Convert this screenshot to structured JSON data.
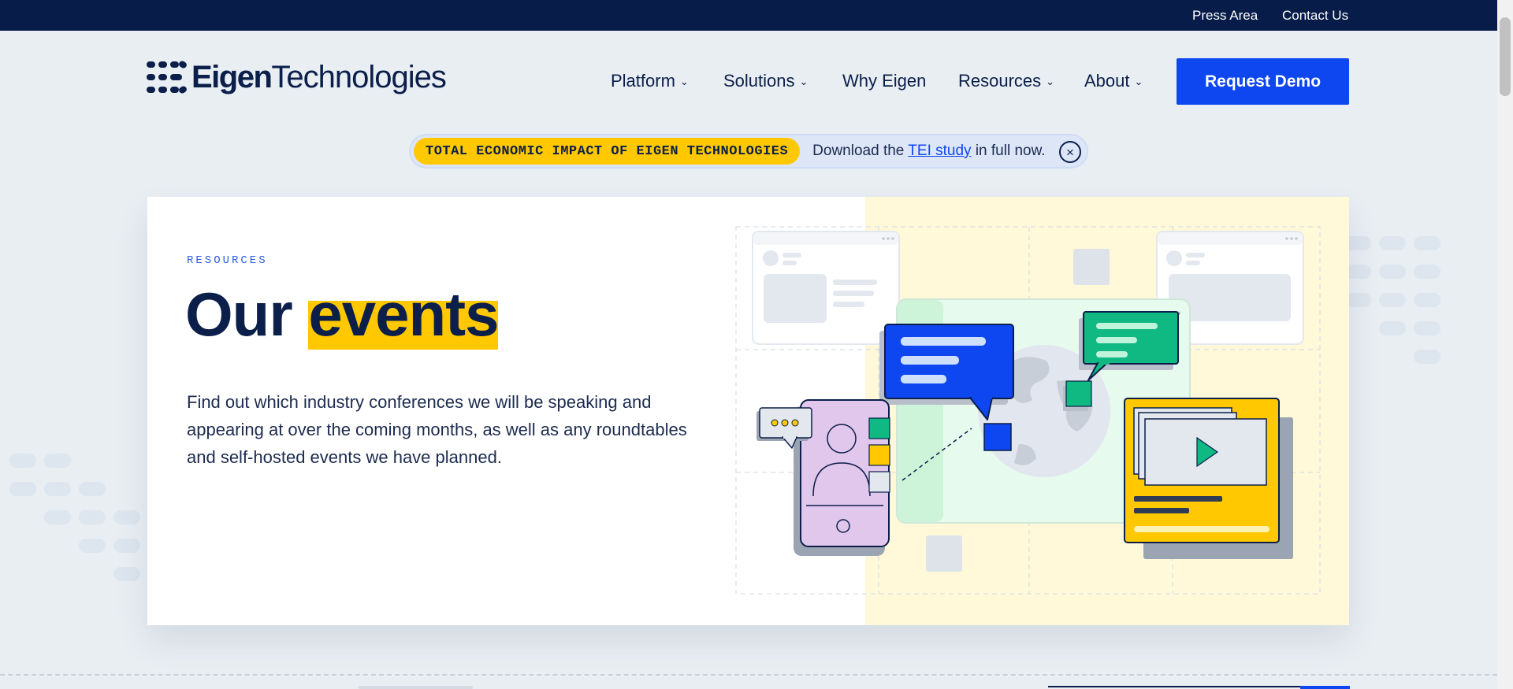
{
  "topbar": {
    "links": [
      "Press Area",
      "Contact Us"
    ]
  },
  "logo": {
    "bold": "Eigen",
    "regular": "Technologies"
  },
  "nav": {
    "items": [
      {
        "label": "Platform",
        "dropdown": true
      },
      {
        "label": "Solutions",
        "dropdown": true
      },
      {
        "label": "Why Eigen",
        "dropdown": false
      },
      {
        "label": "Resources",
        "dropdown": true
      },
      {
        "label": "About",
        "dropdown": true
      }
    ],
    "cta": "Request Demo"
  },
  "banner": {
    "pill": "TOTAL ECONOMIC IMPACT OF EIGEN TECHNOLOGIES",
    "text_before": "Download the ",
    "link": "TEI study",
    "text_after": " in full now.",
    "close_icon": "close-circle-icon"
  },
  "hero": {
    "eyebrow": "RESOURCES",
    "title_plain": "Our ",
    "title_highlight": "events",
    "description": "Find out which industry conferences we will be speaking and appearing at over the coming months, as well as any roundtables and self-hosted events we have planned."
  },
  "colors": {
    "navy": "#071c49",
    "brand_blue": "#0e47f0",
    "highlight_yellow": "#ffc800",
    "page_bg": "#e9eef3",
    "illustration_green": "#10b981",
    "illustration_purple": "#e2c7ec"
  }
}
